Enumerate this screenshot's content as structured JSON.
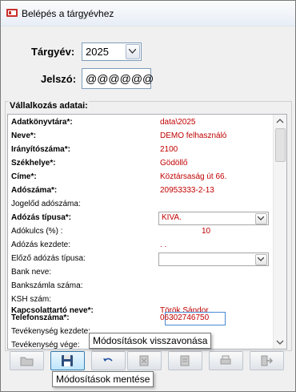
{
  "window": {
    "title": "Belépés a tárgyévhez"
  },
  "login": {
    "year_label": "Tárgyév:",
    "year_value": "2025",
    "password_label": "Jelszó:",
    "password_value": "@@@@@@"
  },
  "company": {
    "group_title": "Vállalkozás adatai:",
    "rows": [
      {
        "label": "Adatkönyvtára*:",
        "value": "data\\2025"
      },
      {
        "label": "Neve*:",
        "value": "DEMO felhasználó"
      },
      {
        "label": "Irányítószáma*:",
        "value": "2100"
      },
      {
        "label": "Székhelye*:",
        "value": "Gödöllő"
      },
      {
        "label": "Címe*:",
        "value": "Köztársaság út 66."
      },
      {
        "label": "Adószáma*:",
        "value": "20953333-2-13"
      },
      {
        "label": "Jogelőd adószáma:",
        "value": ""
      },
      {
        "label": "Adózás típusa*:",
        "value": "KIVA."
      },
      {
        "label": "Adókulcs (%) :",
        "value": "10"
      },
      {
        "label": "Adózás kezdete:",
        "value": ". ."
      },
      {
        "label": "Előző adózás típusa:",
        "value": ""
      },
      {
        "label": "Bank neve:",
        "value": ""
      },
      {
        "label": "Bankszámla száma:",
        "value": ""
      },
      {
        "label": "KSH szám:",
        "value": ""
      },
      {
        "label": "Kapcsolattartó neve*:",
        "value": "Török Sándor"
      },
      {
        "label": "Telefonszáma*:",
        "value": "06302746750"
      },
      {
        "label": "Tevékenység kezdete:",
        "value": ". ."
      },
      {
        "label": "Tevékenység vége:",
        "value": ""
      }
    ]
  },
  "toolbar": {
    "tooltip_undo": "Módosítások visszavonása",
    "tooltip_save": "Módosítások mentése"
  },
  "colors": {
    "value_red": "#c00000",
    "accent": "#3c7fb1"
  }
}
